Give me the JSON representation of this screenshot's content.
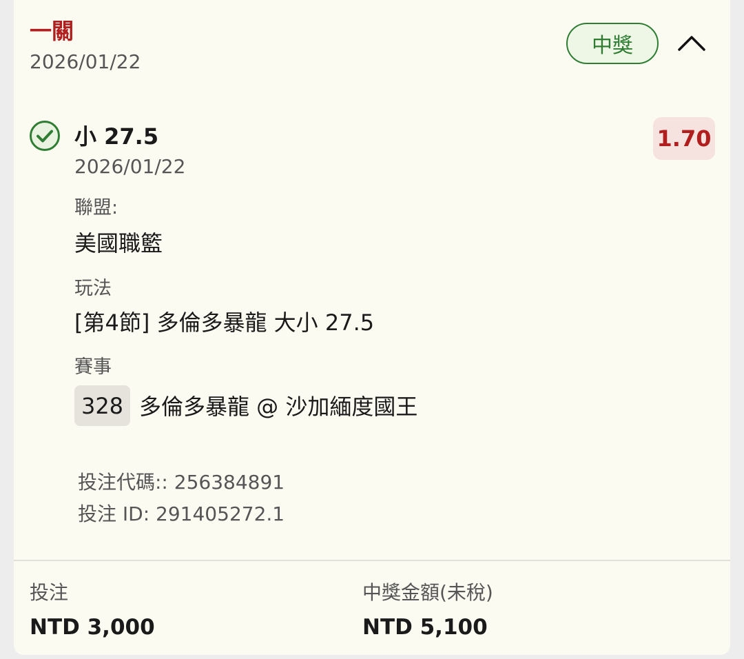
{
  "bet": {
    "type": "一關",
    "date": "2026/01/22",
    "status": "中獎"
  },
  "selection": {
    "name": "小 27.5",
    "date": "2026/01/22",
    "odds": "1.70",
    "league_label": "聯盟:",
    "league": "美國職籃",
    "market_label": "玩法",
    "market": "[第4節] 多倫多暴龍 大小 27.5",
    "event_label": "賽事",
    "event_code": "328",
    "event": "多倫多暴龍 @ 沙加緬度國王"
  },
  "ids": {
    "bet_code": "投注代碼:: 256384891",
    "bet_id": "投注 ID: 291405272.1"
  },
  "summary": {
    "stake_label": "投注",
    "stake": "NTD 3,000",
    "win_label": "中獎金額(未稅)",
    "win_amount": "NTD 5,100"
  },
  "icons": {
    "check": "check-circle-icon",
    "collapse": "chevron-up-icon"
  },
  "colors": {
    "accent_red": "#b01e1e",
    "win_green": "#2e7d32",
    "card_bg": "#fcfbf2"
  }
}
